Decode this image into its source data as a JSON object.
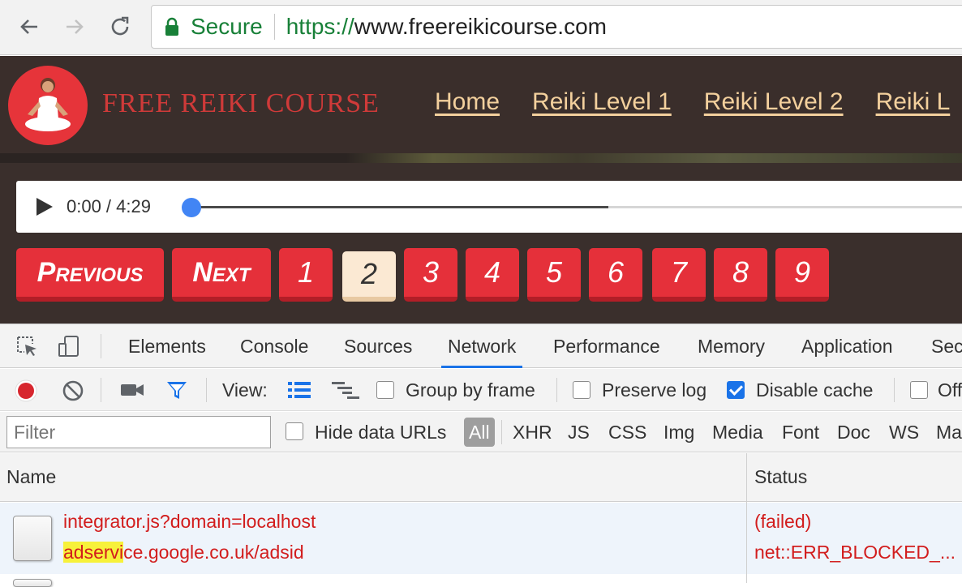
{
  "browser": {
    "secure_label": "Secure",
    "url_scheme": "https://",
    "url_host": "www.freereikicourse.com"
  },
  "site": {
    "logo_text": "FREE REIKI COURSE",
    "nav": [
      "Home",
      "Reiki Level 1",
      "Reiki Level 2",
      "Reiki L"
    ],
    "audio": {
      "time": "0:00 / 4:29",
      "progress": 0
    },
    "pager": {
      "previous": "Previous",
      "next": "Next",
      "pages": [
        "1",
        "2",
        "3",
        "4",
        "5",
        "6",
        "7",
        "8",
        "9"
      ],
      "current": "2"
    },
    "colors": {
      "accent": "#e5303a",
      "nav_link": "#f3d09d",
      "header_bg": "#3a2e2b"
    }
  },
  "devtools": {
    "tabs": [
      "Elements",
      "Console",
      "Sources",
      "Network",
      "Performance",
      "Memory",
      "Application",
      "Sec"
    ],
    "active_tab": "Network",
    "toolbar": {
      "view_label": "View:",
      "group_by_frame": "Group by frame",
      "preserve_log": "Preserve log",
      "disable_cache": "Disable cache",
      "offline": "Off"
    },
    "filter": {
      "placeholder": "Filter",
      "hide_data_urls": "Hide data URLs",
      "types": [
        "All",
        "XHR",
        "JS",
        "CSS",
        "Img",
        "Media",
        "Font",
        "Doc",
        "WS",
        "Ma"
      ]
    },
    "table": {
      "headers": {
        "name": "Name",
        "status": "Status"
      },
      "rows": [
        {
          "name": "integrator.js?domain=localhost",
          "url_highlight": "adservi",
          "url_rest": "ce.google.co.uk/adsid",
          "status": "(failed)",
          "status_detail": "net::ERR_BLOCKED_..."
        }
      ]
    }
  }
}
